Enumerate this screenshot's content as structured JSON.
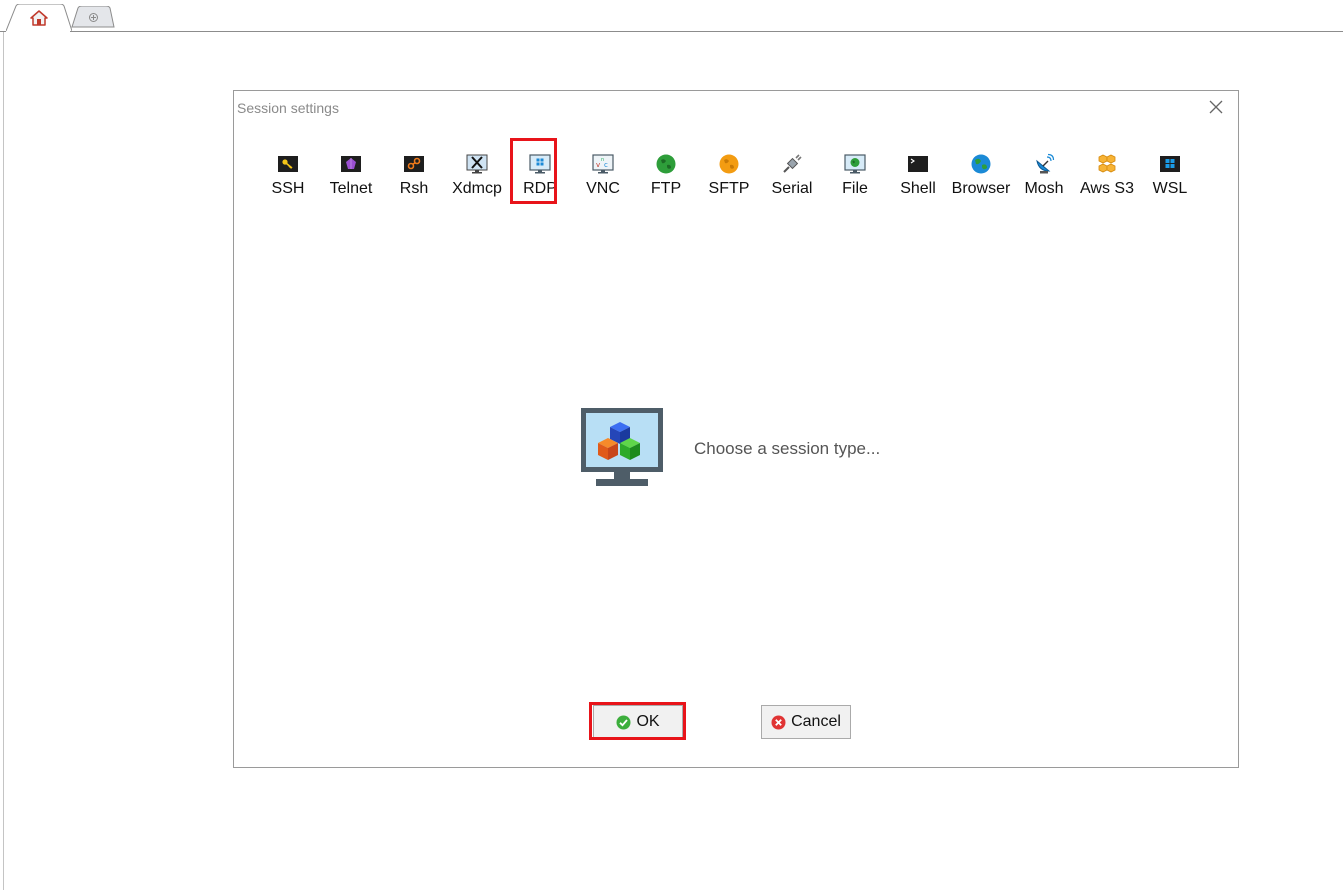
{
  "tabs": {
    "home_icon": "home-icon",
    "new_tab_icon": "plus-icon"
  },
  "dialog": {
    "title": "Session settings",
    "close_icon": "close-icon",
    "session_types": [
      {
        "label": "SSH",
        "icon": "ssh-key-icon"
      },
      {
        "label": "Telnet",
        "icon": "telnet-icon"
      },
      {
        "label": "Rsh",
        "icon": "rsh-icon"
      },
      {
        "label": "Xdmcp",
        "icon": "xdmcp-icon"
      },
      {
        "label": "RDP",
        "icon": "rdp-icon"
      },
      {
        "label": "VNC",
        "icon": "vnc-icon"
      },
      {
        "label": "FTP",
        "icon": "ftp-globe-icon"
      },
      {
        "label": "SFTP",
        "icon": "sftp-globe-icon"
      },
      {
        "label": "Serial",
        "icon": "serial-plug-icon"
      },
      {
        "label": "File",
        "icon": "file-icon"
      },
      {
        "label": "Shell",
        "icon": "shell-terminal-icon"
      },
      {
        "label": "Browser",
        "icon": "browser-globe-icon"
      },
      {
        "label": "Mosh",
        "icon": "mosh-satellite-icon"
      },
      {
        "label": "Aws S3",
        "icon": "aws-s3-icon"
      },
      {
        "label": "WSL",
        "icon": "wsl-windows-icon"
      }
    ],
    "hint_text": "Choose a session type...",
    "ok_label": "OK",
    "cancel_label": "Cancel"
  },
  "colors": {
    "highlight": "#e8141a",
    "ok_icon": "#3cae3c",
    "cancel_icon": "#e03434"
  }
}
